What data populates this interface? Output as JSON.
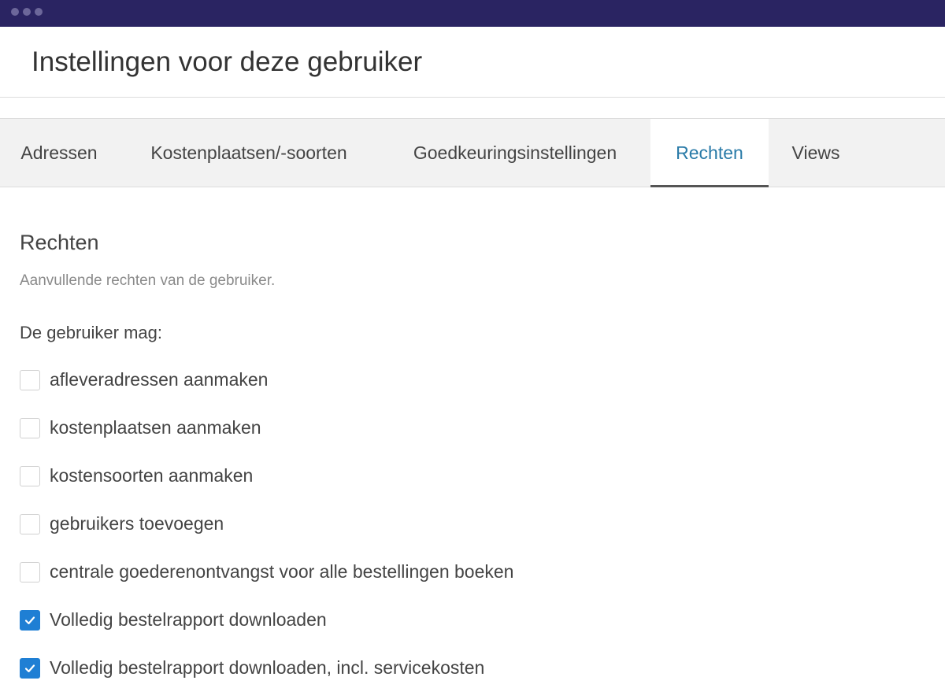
{
  "window": {
    "controls": [
      "dot",
      "dot",
      "dot"
    ]
  },
  "header": {
    "title": "Instellingen voor deze gebruiker"
  },
  "tabs": [
    {
      "label": "Adressen",
      "active": false
    },
    {
      "label": "Kostenplaatsen/-soorten",
      "active": false
    },
    {
      "label": "Goedkeuringsinstellingen",
      "active": false
    },
    {
      "label": "Rechten",
      "active": true
    },
    {
      "label": "Views",
      "active": false
    }
  ],
  "section": {
    "title": "Rechten",
    "description": "Aanvullende rechten van de gebruiker.",
    "intro": "De gebruiker mag:"
  },
  "permissions": [
    {
      "label": "afleveradressen aanmaken",
      "checked": false
    },
    {
      "label": "kostenplaatsen aanmaken",
      "checked": false
    },
    {
      "label": "kostensoorten aanmaken",
      "checked": false
    },
    {
      "label": "gebruikers toevoegen",
      "checked": false
    },
    {
      "label": "centrale goederenontvangst voor alle bestellingen boeken",
      "checked": false
    },
    {
      "label": "Volledig bestelrapport downloaden",
      "checked": true
    },
    {
      "label": "Volledig bestelrapport downloaden, incl. servicekosten",
      "checked": true
    }
  ],
  "colors": {
    "titlebar": "#2a2462",
    "active_tab_text": "#2a7ba8",
    "checkbox_checked": "#1f7fd4"
  }
}
